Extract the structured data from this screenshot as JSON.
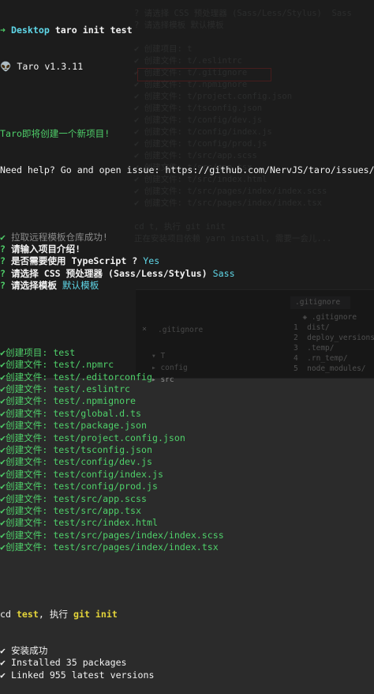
{
  "background": {
    "ghost_lines": [
      {
        "text": "? 请选择 CSS 预处理器 (Sass/Less/Stylus)  Sass",
        "tone": "w"
      },
      {
        "text": "? 请选择模板 默认模板",
        "tone": "w"
      },
      {
        "text": "",
        "tone": "w"
      },
      {
        "text": "✔ 创建项目: t",
        "tone": "w"
      },
      {
        "text": "✔ 创建文件: t/.eslintrc",
        "tone": "w"
      },
      {
        "text": "✔ 创建文件: t/.gitignore",
        "tone": "w"
      },
      {
        "text": "✔ 创建文件: t/.npmignore",
        "tone": "w"
      },
      {
        "text": "✔ 创建文件: t/project.config.json",
        "tone": "w"
      },
      {
        "text": "✔ 创建文件: t/tsconfig.json",
        "tone": "w"
      },
      {
        "text": "✔ 创建文件: t/config/dev.js",
        "tone": "w"
      },
      {
        "text": "✔ 创建文件: t/config/index.js",
        "tone": "w"
      },
      {
        "text": "✔ 创建文件: t/config/prod.js",
        "tone": "w"
      },
      {
        "text": "✔ 创建文件: t/src/app.scss",
        "tone": "w"
      },
      {
        "text": "✔ 创建文件: t/src/app.tsx",
        "tone": "w"
      },
      {
        "text": "✔ 创建文件: t/src/index.html",
        "tone": "w"
      },
      {
        "text": "✔ 创建文件: t/src/pages/index/index.scss",
        "tone": "w"
      },
      {
        "text": "✔ 创建文件: t/src/pages/index/index.tsx",
        "tone": "w"
      },
      {
        "text": "",
        "tone": "w"
      },
      {
        "text": "cd t, 执行 git init",
        "tone": "w"
      },
      {
        "text": "正在安装项目依赖 yarn install, 需要一会儿...",
        "tone": "w"
      }
    ],
    "ide": {
      "tab_right": ".gitignore",
      "tab_left": ".gitignore",
      "tree": [
        "▾ T",
        "  ▸ config",
        "  ▸ src"
      ],
      "file_lines": [
        "  ◈ .gitignore",
        "1  dist/",
        "2  deploy_versions/",
        "3  .temp/",
        "4  .rn_temp/",
        "5  node_modules/"
      ],
      "close_glyph": "×"
    }
  },
  "terminal": {
    "prompt": {
      "arrow": "➜",
      "dir": "Desktop",
      "command": " taro init test"
    },
    "version_line": {
      "icon": "👽",
      "text": " Taro v1.3.11"
    },
    "welcome": "Taro即将创建一个新项目!",
    "help": "Need help? Go and open issue: https://github.com/NervJS/taro/issues/new",
    "steps": [
      {
        "mark": "✔",
        "text": " 拉取远程模板仓库成功!",
        "tone": "dim"
      },
      {
        "mark": "?",
        "text": " 请输入项目介绍!",
        "tone": "w",
        "answer": ""
      },
      {
        "mark": "?",
        "text": " 是否需要使用 TypeScript ?",
        "tone": "w",
        "answer": "Yes"
      },
      {
        "mark": "?",
        "text": " 请选择 CSS 预处理器 (Sass/Less/Stylus)",
        "tone": "w",
        "answer": "Sass"
      },
      {
        "mark": "?",
        "text": " 请选择模板",
        "tone": "w",
        "answer": "默认模板"
      }
    ],
    "created": [
      "创建项目: test",
      "创建文件: test/.npmrc",
      "创建文件: test/.editorconfig",
      "创建文件: test/.eslintrc",
      "创建文件: test/.npmignore",
      "创建文件: test/global.d.ts",
      "创建文件: test/package.json",
      "创建文件: test/project.config.json",
      "创建文件: test/tsconfig.json",
      "创建文件: test/config/dev.js",
      "创建文件: test/config/index.js",
      "创建文件: test/config/prod.js",
      "创建文件: test/src/app.scss",
      "创建文件: test/src/app.tsx",
      "创建文件: test/src/index.html",
      "创建文件: test/src/pages/index/index.scss",
      "创建文件: test/src/pages/index/index.tsx"
    ],
    "git": {
      "prefix": "cd ",
      "dir": "test",
      "mid": ", 执行 ",
      "cmd": "git init"
    },
    "install": [
      "✔ 安装成功",
      "✔ Installed 35 packages",
      "✔ Linked 955 latest versions"
    ],
    "check_mark": "✔"
  },
  "colors": {
    "green": "#4fd06a",
    "yellow": "#e4d43a",
    "cyan": "#5fd7e8",
    "background": "#2b2b2b"
  }
}
